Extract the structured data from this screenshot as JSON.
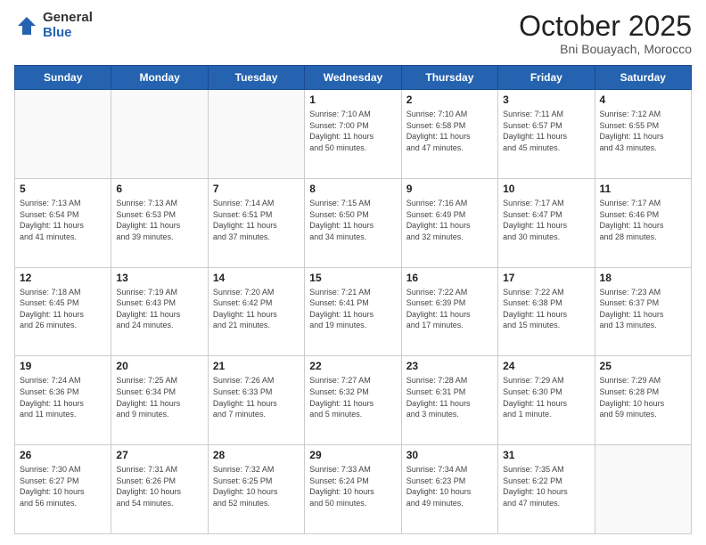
{
  "header": {
    "logo_general": "General",
    "logo_blue": "Blue",
    "month": "October 2025",
    "location": "Bni Bouayach, Morocco"
  },
  "weekdays": [
    "Sunday",
    "Monday",
    "Tuesday",
    "Wednesday",
    "Thursday",
    "Friday",
    "Saturday"
  ],
  "weeks": [
    [
      {
        "day": "",
        "info": ""
      },
      {
        "day": "",
        "info": ""
      },
      {
        "day": "",
        "info": ""
      },
      {
        "day": "1",
        "info": "Sunrise: 7:10 AM\nSunset: 7:00 PM\nDaylight: 11 hours\nand 50 minutes."
      },
      {
        "day": "2",
        "info": "Sunrise: 7:10 AM\nSunset: 6:58 PM\nDaylight: 11 hours\nand 47 minutes."
      },
      {
        "day": "3",
        "info": "Sunrise: 7:11 AM\nSunset: 6:57 PM\nDaylight: 11 hours\nand 45 minutes."
      },
      {
        "day": "4",
        "info": "Sunrise: 7:12 AM\nSunset: 6:55 PM\nDaylight: 11 hours\nand 43 minutes."
      }
    ],
    [
      {
        "day": "5",
        "info": "Sunrise: 7:13 AM\nSunset: 6:54 PM\nDaylight: 11 hours\nand 41 minutes."
      },
      {
        "day": "6",
        "info": "Sunrise: 7:13 AM\nSunset: 6:53 PM\nDaylight: 11 hours\nand 39 minutes."
      },
      {
        "day": "7",
        "info": "Sunrise: 7:14 AM\nSunset: 6:51 PM\nDaylight: 11 hours\nand 37 minutes."
      },
      {
        "day": "8",
        "info": "Sunrise: 7:15 AM\nSunset: 6:50 PM\nDaylight: 11 hours\nand 34 minutes."
      },
      {
        "day": "9",
        "info": "Sunrise: 7:16 AM\nSunset: 6:49 PM\nDaylight: 11 hours\nand 32 minutes."
      },
      {
        "day": "10",
        "info": "Sunrise: 7:17 AM\nSunset: 6:47 PM\nDaylight: 11 hours\nand 30 minutes."
      },
      {
        "day": "11",
        "info": "Sunrise: 7:17 AM\nSunset: 6:46 PM\nDaylight: 11 hours\nand 28 minutes."
      }
    ],
    [
      {
        "day": "12",
        "info": "Sunrise: 7:18 AM\nSunset: 6:45 PM\nDaylight: 11 hours\nand 26 minutes."
      },
      {
        "day": "13",
        "info": "Sunrise: 7:19 AM\nSunset: 6:43 PM\nDaylight: 11 hours\nand 24 minutes."
      },
      {
        "day": "14",
        "info": "Sunrise: 7:20 AM\nSunset: 6:42 PM\nDaylight: 11 hours\nand 21 minutes."
      },
      {
        "day": "15",
        "info": "Sunrise: 7:21 AM\nSunset: 6:41 PM\nDaylight: 11 hours\nand 19 minutes."
      },
      {
        "day": "16",
        "info": "Sunrise: 7:22 AM\nSunset: 6:39 PM\nDaylight: 11 hours\nand 17 minutes."
      },
      {
        "day": "17",
        "info": "Sunrise: 7:22 AM\nSunset: 6:38 PM\nDaylight: 11 hours\nand 15 minutes."
      },
      {
        "day": "18",
        "info": "Sunrise: 7:23 AM\nSunset: 6:37 PM\nDaylight: 11 hours\nand 13 minutes."
      }
    ],
    [
      {
        "day": "19",
        "info": "Sunrise: 7:24 AM\nSunset: 6:36 PM\nDaylight: 11 hours\nand 11 minutes."
      },
      {
        "day": "20",
        "info": "Sunrise: 7:25 AM\nSunset: 6:34 PM\nDaylight: 11 hours\nand 9 minutes."
      },
      {
        "day": "21",
        "info": "Sunrise: 7:26 AM\nSunset: 6:33 PM\nDaylight: 11 hours\nand 7 minutes."
      },
      {
        "day": "22",
        "info": "Sunrise: 7:27 AM\nSunset: 6:32 PM\nDaylight: 11 hours\nand 5 minutes."
      },
      {
        "day": "23",
        "info": "Sunrise: 7:28 AM\nSunset: 6:31 PM\nDaylight: 11 hours\nand 3 minutes."
      },
      {
        "day": "24",
        "info": "Sunrise: 7:29 AM\nSunset: 6:30 PM\nDaylight: 11 hours\nand 1 minute."
      },
      {
        "day": "25",
        "info": "Sunrise: 7:29 AM\nSunset: 6:28 PM\nDaylight: 10 hours\nand 59 minutes."
      }
    ],
    [
      {
        "day": "26",
        "info": "Sunrise: 7:30 AM\nSunset: 6:27 PM\nDaylight: 10 hours\nand 56 minutes."
      },
      {
        "day": "27",
        "info": "Sunrise: 7:31 AM\nSunset: 6:26 PM\nDaylight: 10 hours\nand 54 minutes."
      },
      {
        "day": "28",
        "info": "Sunrise: 7:32 AM\nSunset: 6:25 PM\nDaylight: 10 hours\nand 52 minutes."
      },
      {
        "day": "29",
        "info": "Sunrise: 7:33 AM\nSunset: 6:24 PM\nDaylight: 10 hours\nand 50 minutes."
      },
      {
        "day": "30",
        "info": "Sunrise: 7:34 AM\nSunset: 6:23 PM\nDaylight: 10 hours\nand 49 minutes."
      },
      {
        "day": "31",
        "info": "Sunrise: 7:35 AM\nSunset: 6:22 PM\nDaylight: 10 hours\nand 47 minutes."
      },
      {
        "day": "",
        "info": ""
      }
    ]
  ]
}
